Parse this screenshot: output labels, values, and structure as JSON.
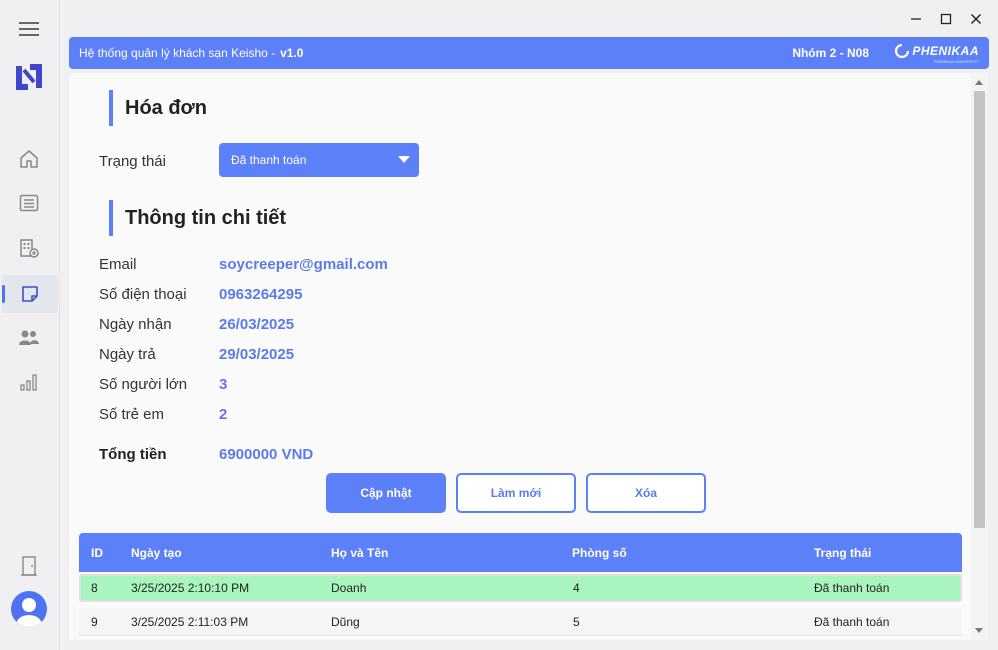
{
  "window": {
    "title": "Hệ thống quản lý khách sạn Keisho -",
    "version": "v1.0",
    "group": "Nhóm 2 - N08",
    "brand": "PHENIKAA",
    "brand_sub": "PHENIKAA UNIVERSITY"
  },
  "sidebar": {
    "items": [
      {
        "icon": "home-icon"
      },
      {
        "icon": "list-icon"
      },
      {
        "icon": "building-add-icon"
      },
      {
        "icon": "invoice-note-icon",
        "active": true
      },
      {
        "icon": "people-icon"
      },
      {
        "icon": "chart-icon"
      }
    ],
    "bottom": [
      {
        "icon": "door-exit-icon"
      },
      {
        "icon": "user-avatar-icon"
      }
    ]
  },
  "invoice": {
    "section_title": "Hóa đơn",
    "status_label": "Trạng thái",
    "status_value": "Đã thanh toán"
  },
  "details": {
    "section_title": "Thông tin chi tiết",
    "fields": [
      {
        "label": "Email",
        "value": "soycreeper@gmail.com"
      },
      {
        "label": "Số điện thoại",
        "value": "0963264295"
      },
      {
        "label": "Ngày nhận",
        "value": "26/03/2025"
      },
      {
        "label": "Ngày trả",
        "value": "29/03/2025"
      },
      {
        "label": "Số người lớn",
        "value": "3"
      },
      {
        "label": "Số trẻ em",
        "value": "2"
      }
    ],
    "total_label": "Tổng tiền",
    "total_value": "6900000 VND"
  },
  "actions": {
    "update": "Cập nhật",
    "refresh": "Làm mới",
    "delete": "Xóa"
  },
  "table": {
    "headers": [
      "ID",
      "Ngày tạo",
      "Họ và Tên",
      "Phòng số",
      "Trạng thái"
    ],
    "rows": [
      [
        "8",
        "3/25/2025 2:10:10 PM",
        "Doanh",
        "4",
        "Đã thanh toán"
      ],
      [
        "9",
        "3/25/2025 2:11:03 PM",
        "Dũng",
        "5",
        "Đã thanh toán"
      ]
    ]
  },
  "colors": {
    "accent": "#5b80f7",
    "value_text": "#5b7bea",
    "selected_row": "#a8f5bf"
  }
}
